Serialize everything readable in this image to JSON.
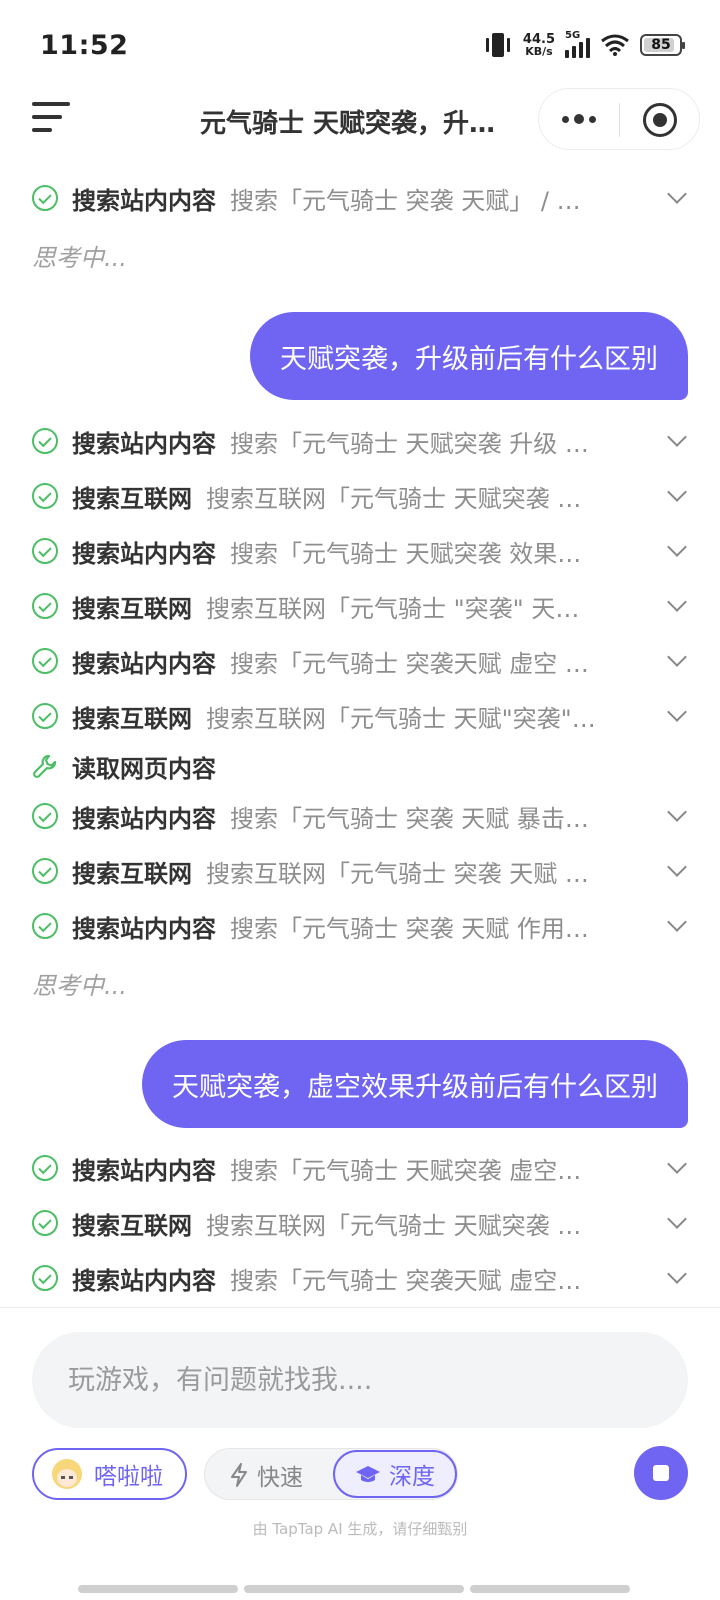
{
  "status_bar": {
    "time": "11:52",
    "net_speed_value": "44.5",
    "net_speed_unit": "KB/s",
    "network_type": "5G",
    "battery": "85"
  },
  "header": {
    "title": "元气骑士 天赋突袭，升…"
  },
  "chat": {
    "first_step": {
      "label": "搜索站内内容",
      "detail": "搜索「元气骑士 突袭 天赋」 / …"
    },
    "thinking_1": "思考中...",
    "user_message_1": "天赋突袭，升级前后有什么区别",
    "steps_block_2": [
      {
        "label": "搜索站内内容",
        "detail": "搜索「元气骑士 天赋突袭 升级 …"
      },
      {
        "label": "搜索互联网",
        "detail": "搜索互联网「元气骑士 天赋突袭 …"
      },
      {
        "label": "搜索站内内容",
        "detail": "搜索「元气骑士 天赋突袭 效果…"
      },
      {
        "label": "搜索互联网",
        "detail": "搜索互联网「元气骑士 \"突袭\" 天…"
      },
      {
        "label": "搜索站内内容",
        "detail": "搜索「元气骑士 突袭天赋 虚空 …"
      },
      {
        "label": "搜索互联网",
        "detail": "搜索互联网「元气骑士 天赋\"突袭\"…"
      },
      {
        "label": "读取网页内容",
        "detail": ""
      },
      {
        "label": "搜索站内内容",
        "detail": "搜索「元气骑士 突袭 天赋 暴击…"
      },
      {
        "label": "搜索互联网",
        "detail": "搜索互联网「元气骑士 突袭 天赋 …"
      },
      {
        "label": "搜索站内内容",
        "detail": "搜索「元气骑士 突袭 天赋 作用…"
      }
    ],
    "thinking_2": "思考中...",
    "user_message_2": "天赋突袭，虚空效果升级前后有什么区别",
    "steps_block_3": [
      {
        "label": "搜索站内内容",
        "detail": "搜索「元气骑士 天赋突袭 虚空…"
      },
      {
        "label": "搜索互联网",
        "detail": "搜索互联网「元气骑士 天赋突袭 …"
      },
      {
        "label": "搜索站内内容",
        "detail": "搜索「元气骑士 突袭天赋 虚空…"
      }
    ]
  },
  "composer": {
    "placeholder": "玩游戏，有问题就找我....",
    "agent_name": "嗒啦啦",
    "mode_fast": "快速",
    "mode_deep": "深度",
    "disclaimer": "由 TapTap AI 生成，请仔细甄别"
  },
  "colors": {
    "accent": "#6f65f2",
    "success": "#4cbf66"
  },
  "icons": [
    "menu-icon",
    "more-icon",
    "target-icon",
    "check-circle-icon",
    "wrench-icon",
    "chevron-down-icon",
    "bolt-icon",
    "graduation-cap-icon",
    "stop-icon"
  ]
}
